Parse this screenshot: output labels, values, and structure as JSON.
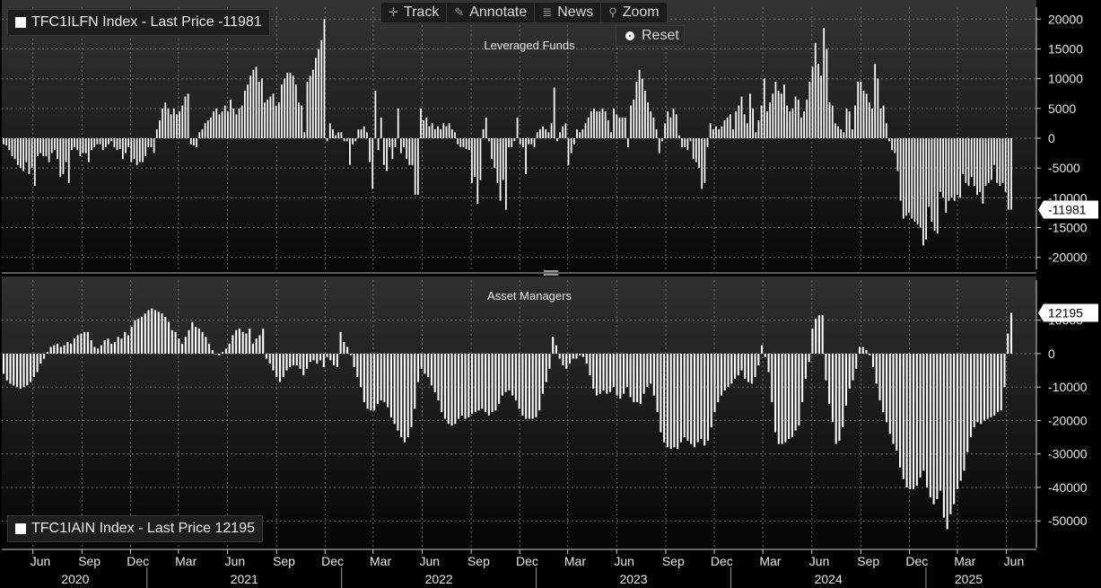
{
  "toolbar": {
    "track_label": "Track",
    "annotate_label": "Annotate",
    "news_label": "News",
    "zoom_label": "Zoom",
    "reset_label": "Reset"
  },
  "colors": {
    "background": "#000000",
    "panel_top": "#343434",
    "panel_bottom": "#060606",
    "bars": "#ffffff",
    "grid": "#8a8a8a"
  },
  "x_axis": {
    "month_labels": [
      "Jun",
      "Sep",
      "Dec",
      "Mar",
      "Jun",
      "Sep",
      "Dec",
      "Mar",
      "Jun",
      "Sep",
      "Dec",
      "Mar",
      "Jun",
      "Sep",
      "Dec",
      "Mar",
      "Jun",
      "Sep",
      "Dec",
      "Mar",
      "Jun"
    ],
    "year_labels": [
      "2020",
      "2021",
      "2022",
      "2023",
      "2024",
      "2025"
    ]
  },
  "chart_data": [
    {
      "type": "bar",
      "title": "Leveraged Funds",
      "legend": "TFC1ILFN Index - Last Price -11981",
      "last_value_label": "-11981",
      "ylim": [
        -22000,
        22000
      ],
      "yticks": [
        20000,
        15000,
        10000,
        5000,
        0,
        -5000,
        -10000,
        -15000,
        -20000
      ],
      "ytick_labels": [
        "20000",
        "15000",
        "10000",
        "5000",
        "0",
        "-5000",
        "-10000",
        "-15000",
        "-20000"
      ],
      "grid": true,
      "frequency": "weekly",
      "x_start": "2020-04-07",
      "x_end": "2025-06-10",
      "values": [
        -1000,
        -1200,
        -2000,
        -3000,
        -3500,
        -4500,
        -5000,
        -5500,
        -4000,
        -6000,
        -5000,
        -8000,
        -3000,
        -2500,
        -3000,
        -3000,
        -4000,
        -2500,
        -2000,
        -3500,
        -6500,
        -6000,
        -4000,
        -7500,
        -2000,
        -1500,
        -2000,
        -3000,
        -2500,
        -2500,
        -4000,
        -2000,
        -1500,
        -1000,
        -1000,
        -2000,
        -1500,
        -1000,
        -500,
        -1500,
        -2000,
        -1800,
        -3500,
        -2500,
        -1500,
        -4000,
        -3500,
        -4500,
        -4000,
        -4000,
        -3000,
        -1500,
        -1500,
        -2500,
        1500,
        3000,
        5000,
        6000,
        5000,
        4000,
        5000,
        4000,
        4500,
        5500,
        7000,
        7500,
        -1000,
        -1200,
        -1500,
        1000,
        1500,
        2500,
        3000,
        3500,
        4500,
        5000,
        4000,
        4500,
        5500,
        4500,
        6500,
        5000,
        4000,
        5000,
        5500,
        8000,
        9000,
        10500,
        11500,
        12000,
        9500,
        10000,
        6000,
        6500,
        7000,
        7500,
        5500,
        6000,
        9000,
        10000,
        11000,
        11000,
        10500,
        9000,
        6000,
        5500,
        1000,
        9500,
        10500,
        11500,
        13500,
        15000,
        16500,
        20000,
        -500,
        2500,
        1500,
        500,
        1000,
        1000,
        -500,
        -500,
        -4500,
        -1000,
        -500,
        1500,
        1500,
        2000,
        1000,
        -4000,
        -8500,
        8000,
        -2000,
        3500,
        -4500,
        -5500,
        -1500,
        -3500,
        -1500,
        5000,
        -2500,
        -1500,
        -3500,
        -4500,
        -4500,
        -9500,
        -9500,
        5000,
        3000,
        3500,
        2000,
        2500,
        1500,
        2000,
        1500,
        2500,
        2000,
        2500,
        1500,
        1000,
        -1000,
        -1500,
        -1500,
        -1800,
        -2000,
        -7500,
        -6500,
        -11000,
        -7000,
        1500,
        3500,
        -500,
        -3500,
        -5000,
        -7500,
        -10500,
        -7000,
        -12000,
        -1500,
        -1500,
        -500,
        3500,
        -1000,
        -1500,
        -6000,
        -1000,
        -1000,
        -1500,
        1000,
        1500,
        2000,
        1500,
        1000,
        2500,
        8500,
        -500,
        1000,
        2000,
        2500,
        -4500,
        -2500,
        -1000,
        1500,
        1000,
        1500,
        2500,
        3500,
        4500,
        5000,
        4500,
        4500,
        5000,
        4500,
        3000,
        1000,
        5000,
        4000,
        3500,
        3500,
        3500,
        -1500,
        5500,
        6500,
        9500,
        11500,
        10000,
        8000,
        6000,
        4500,
        3500,
        1500,
        -2500,
        -500,
        2500,
        4500,
        3500,
        5000,
        4000,
        500,
        -1500,
        -1500,
        -2000,
        -500,
        -3500,
        -4000,
        -5000,
        -8500,
        -7500,
        -1500,
        2500,
        1500,
        2000,
        1500,
        2000,
        3000,
        3500,
        4000,
        1500,
        4500,
        5500,
        7000,
        4000,
        2500,
        7500,
        5000,
        1000,
        3000,
        5500,
        10000,
        4500,
        6000,
        7500,
        9500,
        8000,
        7500,
        9000,
        5500,
        4500,
        5000,
        7000,
        6500,
        3500,
        4500,
        6500,
        9500,
        12000,
        16000,
        12500,
        10500,
        18500,
        15000,
        6000,
        5500,
        2500,
        2000,
        1500,
        1000,
        5000,
        4500,
        1500,
        5500,
        9500,
        9500,
        8000,
        7500,
        6000,
        5000,
        12500,
        10000,
        5000,
        5500,
        2500,
        -500,
        -2000,
        -2500,
        -5500,
        -10500,
        -13500,
        -13000,
        -12500,
        -13500,
        -14000,
        -14500,
        -15000,
        -18000,
        -17000,
        -11500,
        -14000,
        -15500,
        -16000,
        -9000,
        -10000,
        -12500,
        -10500,
        -10000,
        -10500,
        -9500,
        -10000,
        -6000,
        -7500,
        -8000,
        -6500,
        -8000,
        -9500,
        -9000,
        -11000,
        -8000,
        -7500,
        -7000,
        -4500,
        -7500,
        -8000,
        -7500,
        -9000,
        -12000,
        -11981
      ]
    },
    {
      "type": "bar",
      "title": "Asset Managers",
      "legend": "TFC1IAIN Index - Last Price 12195",
      "last_value_label": "12195",
      "ylim": [
        -58000,
        22000
      ],
      "yticks": [
        10000,
        0,
        -10000,
        -20000,
        -30000,
        -40000,
        -50000
      ],
      "ytick_labels": [
        "10000",
        "0",
        "-10000",
        "-20000",
        "-30000",
        "-40000",
        "-50000"
      ],
      "grid": true,
      "frequency": "weekly",
      "x_start": "2020-04-07",
      "x_end": "2025-06-10",
      "values": [
        -6000,
        -8000,
        -9000,
        -9500,
        -10000,
        -10500,
        -10000,
        -9500,
        -8500,
        -7000,
        -5500,
        -3000,
        -1500,
        500,
        2000,
        2500,
        3000,
        2000,
        2500,
        3500,
        3000,
        4500,
        5500,
        6000,
        6500,
        6500,
        4000,
        2000,
        1500,
        2500,
        4000,
        4500,
        3000,
        3500,
        5000,
        4500,
        6500,
        5500,
        8000,
        10000,
        10500,
        11000,
        12000,
        13000,
        13500,
        13000,
        12500,
        12000,
        11000,
        9500,
        7000,
        6500,
        4500,
        3000,
        5000,
        7000,
        9500,
        8000,
        7500,
        6500,
        5000,
        3000,
        1000,
        0,
        -500,
        500,
        1500,
        3000,
        5500,
        7000,
        7500,
        6500,
        6000,
        7500,
        3000,
        4500,
        5500,
        7500,
        -1500,
        -3000,
        -5000,
        -7000,
        -8500,
        -7000,
        -5000,
        -4000,
        -3500,
        -3500,
        -4500,
        -6500,
        -4500,
        -2500,
        -2000,
        -3000,
        -2000,
        -4000,
        -1000,
        -2000,
        -3500,
        -4000,
        6500,
        3500,
        2000,
        -500,
        -4000,
        -7000,
        -10000,
        -14500,
        -16500,
        -17000,
        -17000,
        -15000,
        -14000,
        -14500,
        -16000,
        -19000,
        -21000,
        -23000,
        -25000,
        -26500,
        -25000,
        -22000,
        -16500,
        -8500,
        -4500,
        -6000,
        -7000,
        -9500,
        -11500,
        -14000,
        -17500,
        -19500,
        -21000,
        -21500,
        -21000,
        -19500,
        -18500,
        -19500,
        -19000,
        -18000,
        -17500,
        -17000,
        -16500,
        -17500,
        -18500,
        -17500,
        -17000,
        -15000,
        -12500,
        -11500,
        -11000,
        -12500,
        -14000,
        -16500,
        -18500,
        -19500,
        -19500,
        -19500,
        -19000,
        -17000,
        -12000,
        -8500,
        -4500,
        5000,
        2500,
        -1500,
        -3500,
        -4500,
        -3000,
        -1500,
        -1500,
        -500,
        -1000,
        -3000,
        -6500,
        -10500,
        -12500,
        -12000,
        -11000,
        -12000,
        -11500,
        -10000,
        -12500,
        -13500,
        -12000,
        -10000,
        -13000,
        -14500,
        -14500,
        -15000,
        -12000,
        -10000,
        -9000,
        -12500,
        -17500,
        -23500,
        -26500,
        -28000,
        -28500,
        -28000,
        -28500,
        -26500,
        -25000,
        -26000,
        -27000,
        -28000,
        -26500,
        -25500,
        -27500,
        -26000,
        -22000,
        -17500,
        -14500,
        -12500,
        -11000,
        -10000,
        -9000,
        -7500,
        -6500,
        -5000,
        -7500,
        -8500,
        -9000,
        -7000,
        -3500,
        2500,
        -1000,
        -5500,
        -14500,
        -23500,
        -27000,
        -27000,
        -26500,
        -25500,
        -25000,
        -23000,
        -21500,
        -14500,
        -7500,
        -2500,
        7500,
        10500,
        11500,
        11500,
        -8000,
        -15000,
        -20500,
        -27000,
        -26000,
        -22000,
        -15500,
        -10500,
        -8000,
        -4500,
        2000,
        2000,
        1000,
        -500,
        -4000,
        -9000,
        -14000,
        -17500,
        -20500,
        -24000,
        -27000,
        -29000,
        -34000,
        -37500,
        -40000,
        -40500,
        -40500,
        -39500,
        -37000,
        -35000,
        -40000,
        -43000,
        -45000,
        -43500,
        -41000,
        -49000,
        -52500,
        -48000,
        -45000,
        -40500,
        -38000,
        -35000,
        -29500,
        -25000,
        -22000,
        -20500,
        -21000,
        -20000,
        -19500,
        -19000,
        -18500,
        -17500,
        -17000,
        -10000,
        6000,
        12195
      ]
    }
  ]
}
